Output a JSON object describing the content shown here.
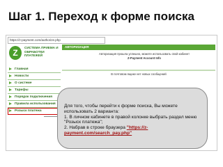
{
  "slide": {
    "title": "Шаг 1. Переход к форме поиска"
  },
  "browser": {
    "url": "https://z-payment.com/authorize.php"
  },
  "site": {
    "logo_letter": "Z",
    "logo_text": "СИСТЕМА ПРИЕМА И ОБРАБОТКИ ПЛАТЕЖЕЙ",
    "auth_label": "АВТОРИЗАЦИЯ",
    "auth_prompt": "Авторизация прошла успешно, можете использовать свой кабинет",
    "auth_brand": "Z-Payment Account Info",
    "inbox_message": "В почтовом ящике нет новых сообщений",
    "nav": [
      {
        "label": "Главная"
      },
      {
        "label": "Новости"
      },
      {
        "label": "О системе"
      },
      {
        "label": "Тарифы"
      },
      {
        "label": "Порядок подключения"
      },
      {
        "label": "Правила использования"
      },
      {
        "label": "Розыск платежа"
      }
    ]
  },
  "callout": {
    "line1": "Для того, чтобы перейти к форме поиска, Вы можете использовать 2 варианта:",
    "line2": "1. В личном кабинете в правой колонке выбрать раздел меню \"Розыск платежа\";",
    "line3": "2. Набрав в строке браузера ",
    "link": "\"https://z-payment.com/search_pay.php\""
  },
  "colors": {
    "brand_green": "#5aa735",
    "highlight_red": "#cc0000",
    "link_red": "#a01010"
  }
}
